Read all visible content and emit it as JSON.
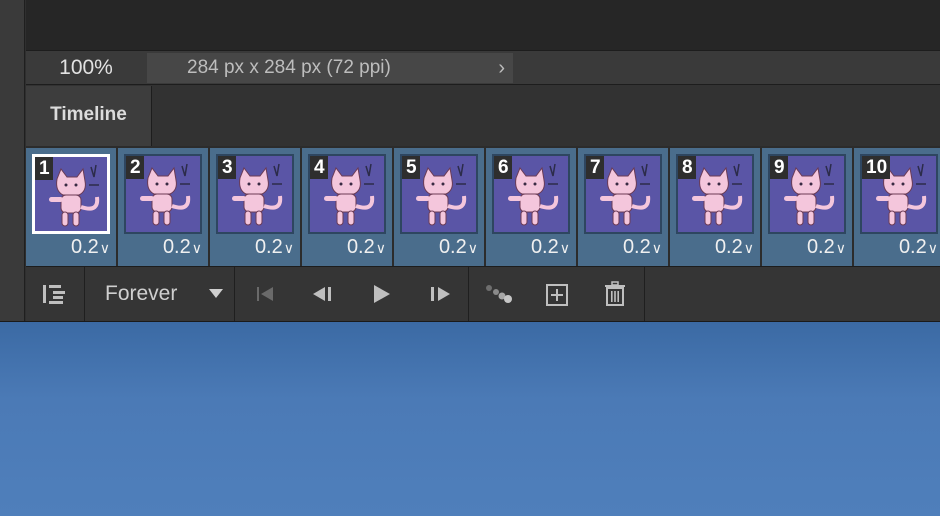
{
  "status_bar": {
    "zoom": "100%",
    "doc_info": "284 px x 284 px (72 ppi)",
    "chevron": "›"
  },
  "panel": {
    "tab_label": "Timeline"
  },
  "frames": [
    {
      "number": "1",
      "delay": "0.2",
      "selected": true
    },
    {
      "number": "2",
      "delay": "0.2",
      "selected": false
    },
    {
      "number": "3",
      "delay": "0.2",
      "selected": false
    },
    {
      "number": "4",
      "delay": "0.2",
      "selected": false
    },
    {
      "number": "5",
      "delay": "0.2",
      "selected": false
    },
    {
      "number": "6",
      "delay": "0.2",
      "selected": false
    },
    {
      "number": "7",
      "delay": "0.2",
      "selected": false
    },
    {
      "number": "8",
      "delay": "0.2",
      "selected": false
    },
    {
      "number": "9",
      "delay": "0.2",
      "selected": false
    },
    {
      "number": "10",
      "delay": "0.2",
      "selected": false
    }
  ],
  "toolbar": {
    "loop_option": "Forever",
    "icons": {
      "convert": "timeline-convert-icon",
      "first": "first-frame-icon",
      "prev": "previous-frame-icon",
      "play": "play-icon",
      "next": "next-frame-icon",
      "tween": "tween-icon",
      "duplicate": "duplicate-frame-icon",
      "delete": "trash-icon"
    }
  },
  "colors": {
    "panel_bg": "#2f2f2f",
    "frame_bg": "#4a6d8c",
    "thumb_bg": "#5a55a6",
    "cat": "#f4c6dc",
    "desktop_blue": "#4f7fbb"
  }
}
